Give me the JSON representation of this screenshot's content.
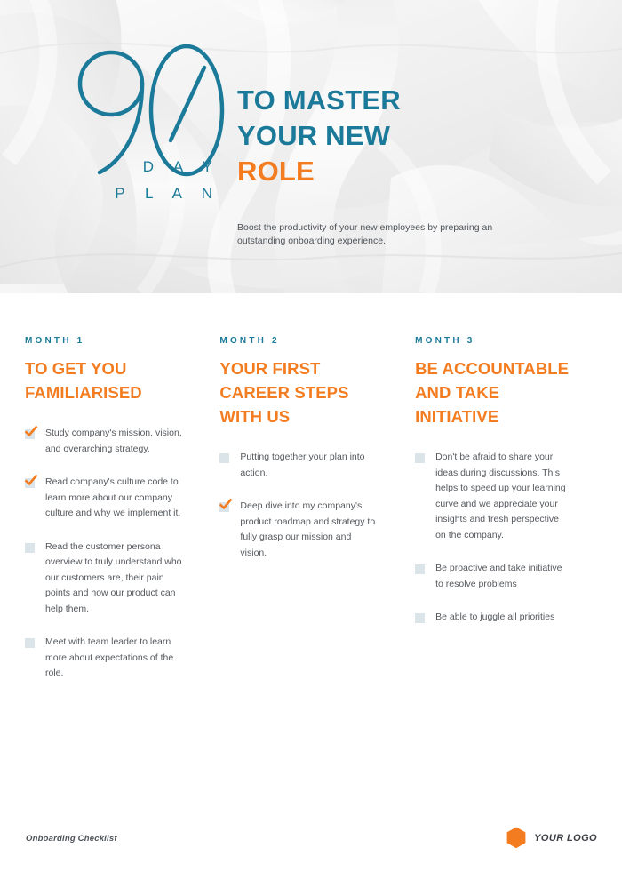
{
  "header": {
    "logo_number": "90",
    "logo_line1": "D A Y",
    "logo_line2": "P L A N",
    "title_line1": "TO MASTER",
    "title_line2": "YOUR NEW",
    "title_line3": "ROLE",
    "subtitle": "Boost the productivity of your new employees by preparing an outstanding onboarding experience."
  },
  "colors": {
    "teal": "#1b7a99",
    "orange": "#f47c20",
    "checkbox": "#dbe5e9",
    "body_text": "#55595e"
  },
  "columns": [
    {
      "kicker": "MONTH 1",
      "title": "TO GET YOU FAMILIARISED",
      "items": [
        {
          "checked": true,
          "text": "Study company's mission, vision, and overarching strategy."
        },
        {
          "checked": true,
          "text": "Read company's culture code to learn more about our company culture and why we implement it."
        },
        {
          "checked": false,
          "text": "Read the customer persona overview to truly understand who our customers are, their pain points and how our product can help them."
        },
        {
          "checked": false,
          "text": "Meet with team leader to learn more about expectations of the role."
        }
      ]
    },
    {
      "kicker": "MONTH 2",
      "title": "YOUR FIRST CAREER STEPS WITH US",
      "items": [
        {
          "checked": false,
          "text": "Putting together your plan into action."
        },
        {
          "checked": true,
          "text": "Deep dive into my company's product roadmap and strategy to fully grasp our mission and vision."
        }
      ]
    },
    {
      "kicker": "MONTH 3",
      "title": "BE ACCOUNTABLE AND TAKE INITIATIVE",
      "items": [
        {
          "checked": false,
          "text": "Don't be afraid to share your ideas during discussions. This helps to speed up your learning curve and we appreciate your insights and fresh perspective on the company."
        },
        {
          "checked": false,
          "text": "Be proactive and take initiative to resolve problems"
        },
        {
          "checked": false,
          "text": "Be able to juggle all priorities"
        }
      ]
    }
  ],
  "footer": {
    "note": "Onboarding Checklist",
    "brand_label": "YOUR LOGO",
    "brand_icon": "hexagon-icon"
  }
}
